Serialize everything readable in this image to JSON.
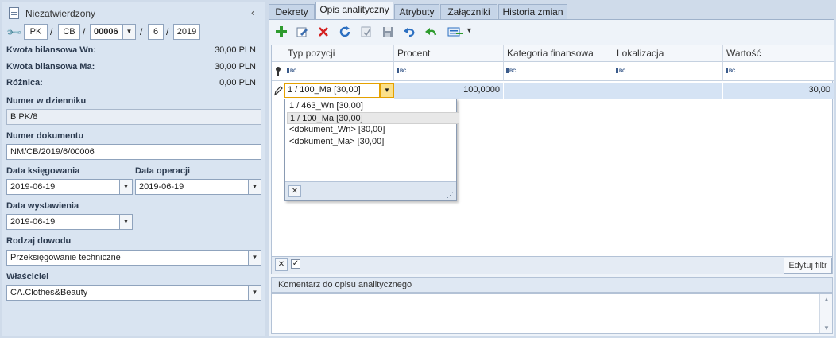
{
  "left_panel": {
    "status": "Niezatwierdzony",
    "doc_number_parts": [
      "PK",
      "CB",
      "00006",
      "6",
      "2019"
    ],
    "separators": [
      "/",
      "/",
      "/",
      "/"
    ],
    "kwota_wn_label": "Kwota bilansowa Wn:",
    "kwota_wn_value": "30,00 PLN",
    "kwota_ma_label": "Kwota bilansowa Ma:",
    "kwota_ma_value": "30,00 PLN",
    "roznica_label": "Różnica:",
    "roznica_value": "0,00 PLN",
    "numer_dziennik_label": "Numer w dzienniku",
    "numer_dziennik_value": "B PK/8",
    "numer_dokumentu_label": "Numer dokumentu",
    "numer_dokumentu_value": "NM/CB/2019/6/00006",
    "data_ksiegowania_label": "Data księgowania",
    "data_ksiegowania_value": "2019-06-19",
    "data_operacji_label": "Data operacji",
    "data_operacji_value": "2019-06-19",
    "data_wystawienia_label": "Data wystawienia",
    "data_wystawienia_value": "2019-06-19",
    "rodzaj_dowodu_label": "Rodzaj dowodu",
    "rodzaj_dowodu_value": "Przeksięgowanie techniczne",
    "wlasciciel_label": "Właściciel",
    "wlasciciel_value": "CA.Clothes&Beauty"
  },
  "tabs": [
    "Dekrety",
    "Opis analityczny",
    "Atrybuty",
    "Załączniki",
    "Historia zmian"
  ],
  "active_tab": "Opis analityczny",
  "toolbar_icons": [
    "add-icon",
    "edit-icon",
    "delete-icon",
    "refresh-icon",
    "bulk-edit-icon",
    "save-icon",
    "undo-icon",
    "back-icon",
    "export-icon"
  ],
  "grid": {
    "columns": [
      "Typ pozycji",
      "Procent",
      "Kategoria finansowa",
      "Lokalizacja",
      "Wartość"
    ],
    "filter_placeholder": "BC",
    "row": {
      "typ": "1 / 100_Ma [30,00]",
      "procent": "100,0000",
      "kategoria": "",
      "lokalizacja": "",
      "wartosc": "30,00"
    },
    "dropdown_options": [
      "1 / 463_Wn [30,00]",
      "1 / 100_Ma [30,00]",
      "<dokument_Wn> [30,00]",
      "<dokument_Ma> [30,00]"
    ],
    "dropdown_selected_index": 1
  },
  "footer": {
    "edit_filter_label": "Edytuj filtr"
  },
  "comment": {
    "header": "Komentarz do opisu analitycznego",
    "value": ""
  },
  "colors": {
    "accent_green": "#2e9b2e",
    "delete_red": "#d42020",
    "selected_row": "#d5e3f4",
    "panel_bg": "#d9e4f1"
  }
}
